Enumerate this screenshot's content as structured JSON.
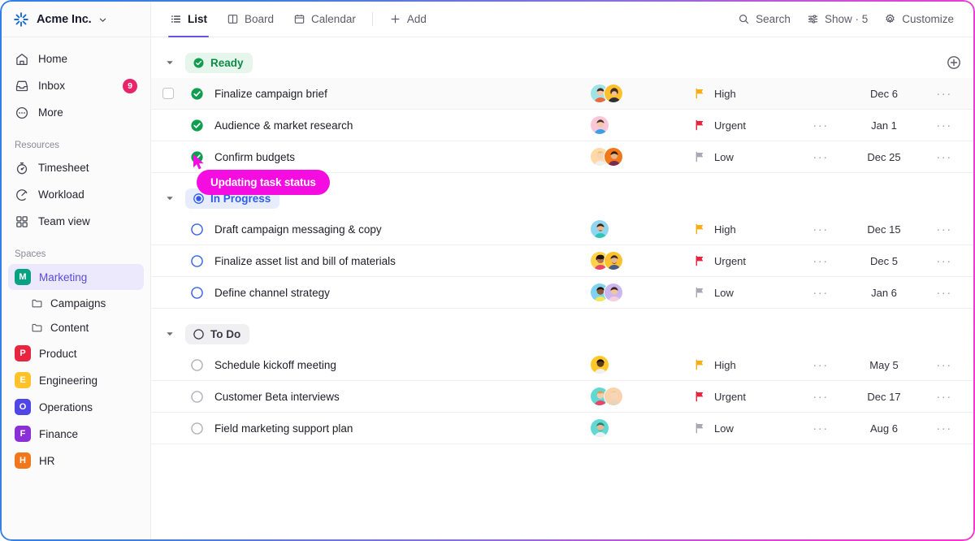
{
  "sidebar": {
    "brand": {
      "name": "Acme Inc.",
      "logo_icon": "sparkle-logo-icon",
      "caret_icon": "chevron-down-icon"
    },
    "nav": [
      {
        "label": "Home",
        "icon": "home-icon"
      },
      {
        "label": "Inbox",
        "icon": "inbox-icon",
        "badge": "9"
      },
      {
        "label": "More",
        "icon": "more-circle-icon"
      }
    ],
    "resources_title": "Resources",
    "resources": [
      {
        "label": "Timesheet",
        "icon": "stopwatch-icon"
      },
      {
        "label": "Workload",
        "icon": "gauge-icon"
      },
      {
        "label": "Team view",
        "icon": "grid-icon"
      }
    ],
    "spaces_title": "Spaces",
    "spaces": [
      {
        "label": "Marketing",
        "initial": "M",
        "color": "#09a184",
        "active": true
      },
      {
        "label": "Product",
        "initial": "P",
        "color": "#e8243f",
        "active": false
      },
      {
        "label": "Engineering",
        "initial": "E",
        "color": "#ffc229",
        "active": false
      },
      {
        "label": "Operations",
        "initial": "O",
        "color": "#4f46e5",
        "active": false
      },
      {
        "label": "Finance",
        "initial": "F",
        "color": "#8b2fd6",
        "active": false
      },
      {
        "label": "HR",
        "initial": "H",
        "color": "#f2761a",
        "active": false
      }
    ],
    "folders": [
      {
        "label": "Campaigns",
        "icon": "folder-icon"
      },
      {
        "label": "Content",
        "icon": "folder-icon"
      }
    ],
    "active_space_text_color": "#5a4bd6",
    "active_space_bg_color": "#ece9fd",
    "badge_color": "#e8256b"
  },
  "topbar": {
    "tabs": [
      {
        "label": "List",
        "icon": "list-icon",
        "active": true
      },
      {
        "label": "Board",
        "icon": "board-icon",
        "active": false
      },
      {
        "label": "Calendar",
        "icon": "calendar-icon",
        "active": false
      }
    ],
    "add_label": "Add",
    "add_icon": "plus-icon",
    "tools": [
      {
        "label": "Search",
        "icon": "search-icon"
      },
      {
        "label": "Show · 5",
        "icon": "sliders-icon"
      },
      {
        "label": "Customize",
        "icon": "gear-icon"
      }
    ],
    "active_tab_accent": "#6c4ee0"
  },
  "groups": [
    {
      "name": "Ready",
      "style": "ready",
      "status_icon": "check-circle-filled-icon",
      "caret_icon": "caret-down-icon",
      "add_icon": "plus-circle-icon",
      "show_add": true,
      "tasks": [
        {
          "title": "Finalize campaign brief",
          "status_icon": "check-circle-filled-icon",
          "priority": "High",
          "priority_color": "#f6ad16",
          "date": "Dec 6",
          "dots": "",
          "more": "···",
          "hovered": true,
          "checkbox": true,
          "avatars": [
            {
              "bg": "#9fe3e8",
              "skin": "#f3c6a5",
              "hair": "#3a2a22",
              "shirt": "#e86a3c"
            },
            {
              "bg": "#ffc02e",
              "skin": "#f0c0a0",
              "hair": "#4a2e1e",
              "shirt": "#2f2f3a"
            }
          ]
        },
        {
          "title": "Audience & market research",
          "status_icon": "check-circle-filled-icon",
          "priority": "Urgent",
          "priority_color": "#e8243f",
          "date": "Jan 1",
          "dots": "···",
          "more": "···",
          "hovered": false,
          "checkbox": false,
          "avatars": [
            {
              "bg": "#fbc7d8",
              "skin": "#f4c9a8",
              "hair": "#4a3326",
              "shirt": "#3aa0e8"
            }
          ]
        },
        {
          "title": "Confirm budgets",
          "status_icon": "check-circle-filled-icon",
          "priority": "Low",
          "priority_color": "#a8a8b4",
          "date": "Dec 25",
          "dots": "···",
          "more": "···",
          "hovered": false,
          "checkbox": false,
          "avatars": [
            {
              "bg": "#ffd9a8",
              "skin": "#f7d3b4",
              "hair": "#e8c271",
              "shirt": "#f0f0f3"
            },
            {
              "bg": "#f2761a",
              "skin": "#e8b389",
              "hair": "#2e1c12",
              "shirt": "#7a2b50"
            }
          ]
        }
      ]
    },
    {
      "name": "In Progress",
      "style": "progress",
      "status_icon": "radio-filled-icon",
      "caret_icon": "caret-down-icon",
      "show_add": false,
      "tasks": [
        {
          "title": "Draft campaign messaging & copy",
          "status_icon": "circle-outline-blue-icon",
          "priority": "High",
          "priority_color": "#f6ad16",
          "date": "Dec 15",
          "dots": "···",
          "more": "···",
          "hovered": false,
          "checkbox": false,
          "avatars": [
            {
              "bg": "#8fd6f2",
              "skin": "#e8b88f",
              "hair": "#3a2418",
              "shirt": "#2ec4b6"
            }
          ]
        },
        {
          "title": "Finalize asset list and bill of materials",
          "status_icon": "circle-outline-blue-icon",
          "priority": "Urgent",
          "priority_color": "#e8243f",
          "date": "Dec 5",
          "dots": "···",
          "more": "···",
          "hovered": false,
          "checkbox": false,
          "avatars": [
            {
              "bg": "#ffd24d",
              "skin": "#b5754a",
              "hair": "#241208",
              "shirt": "#e8456b"
            },
            {
              "bg": "#ffc02e",
              "skin": "#e8b38c",
              "hair": "#3a2a1c",
              "shirt": "#4a5a8a"
            }
          ]
        },
        {
          "title": "Define channel strategy",
          "status_icon": "circle-outline-blue-icon",
          "priority": "Low",
          "priority_color": "#a8a8b4",
          "date": "Jan 6",
          "dots": "···",
          "more": "···",
          "hovered": false,
          "checkbox": false,
          "avatars": [
            {
              "bg": "#7fd2ef",
              "skin": "#8a5a38",
              "hair": "#1e1008",
              "shirt": "#f2e857"
            },
            {
              "bg": "#cbb6f0",
              "skin": "#efc3a3",
              "hair": "#3b2418",
              "shirt": "#f7cfe0"
            }
          ]
        }
      ]
    },
    {
      "name": "To Do",
      "style": "todo",
      "status_icon": "circle-outline-dark-icon",
      "caret_icon": "caret-down-icon",
      "show_add": false,
      "tasks": [
        {
          "title": "Schedule kickoff meeting",
          "status_icon": "circle-outline-gray-icon",
          "priority": "High",
          "priority_color": "#f6ad16",
          "date": "May 5",
          "dots": "···",
          "more": "···",
          "hovered": false,
          "checkbox": false,
          "avatars": [
            {
              "bg": "#ffc829",
              "skin": "#5e3a22",
              "hair": "#150a04",
              "shirt": "#f0f0f3"
            }
          ]
        },
        {
          "title": "Customer Beta interviews",
          "status_icon": "circle-outline-gray-icon",
          "priority": "Urgent",
          "priority_color": "#e8243f",
          "date": "Dec 17",
          "dots": "···",
          "more": "···",
          "hovered": false,
          "checkbox": false,
          "avatars": [
            {
              "bg": "#5fd9d2",
              "skin": "#f3cdae",
              "hair": "#d9a05a",
              "shirt": "#e8456b"
            },
            {
              "bg": "#fbd2ae",
              "skin": "#f6d6bb",
              "hair": "#f0d07a",
              "shirt": "#e8d4b8"
            }
          ]
        },
        {
          "title": "Field marketing support plan",
          "status_icon": "circle-outline-gray-icon",
          "priority": "Low",
          "priority_color": "#a8a8b4",
          "date": "Aug 6",
          "dots": "···",
          "more": "···",
          "hovered": false,
          "checkbox": false,
          "avatars": [
            {
              "bg": "#5fd9d2",
              "skin": "#e8b98f",
              "hair": "#2f7d72",
              "shirt": "#f0f0f3"
            }
          ]
        }
      ]
    }
  ],
  "cursor": {
    "tooltip_text": "Updating task status",
    "tooltip_color": "#f50ce0",
    "pointer_icon": "mouse-pointer-icon"
  }
}
